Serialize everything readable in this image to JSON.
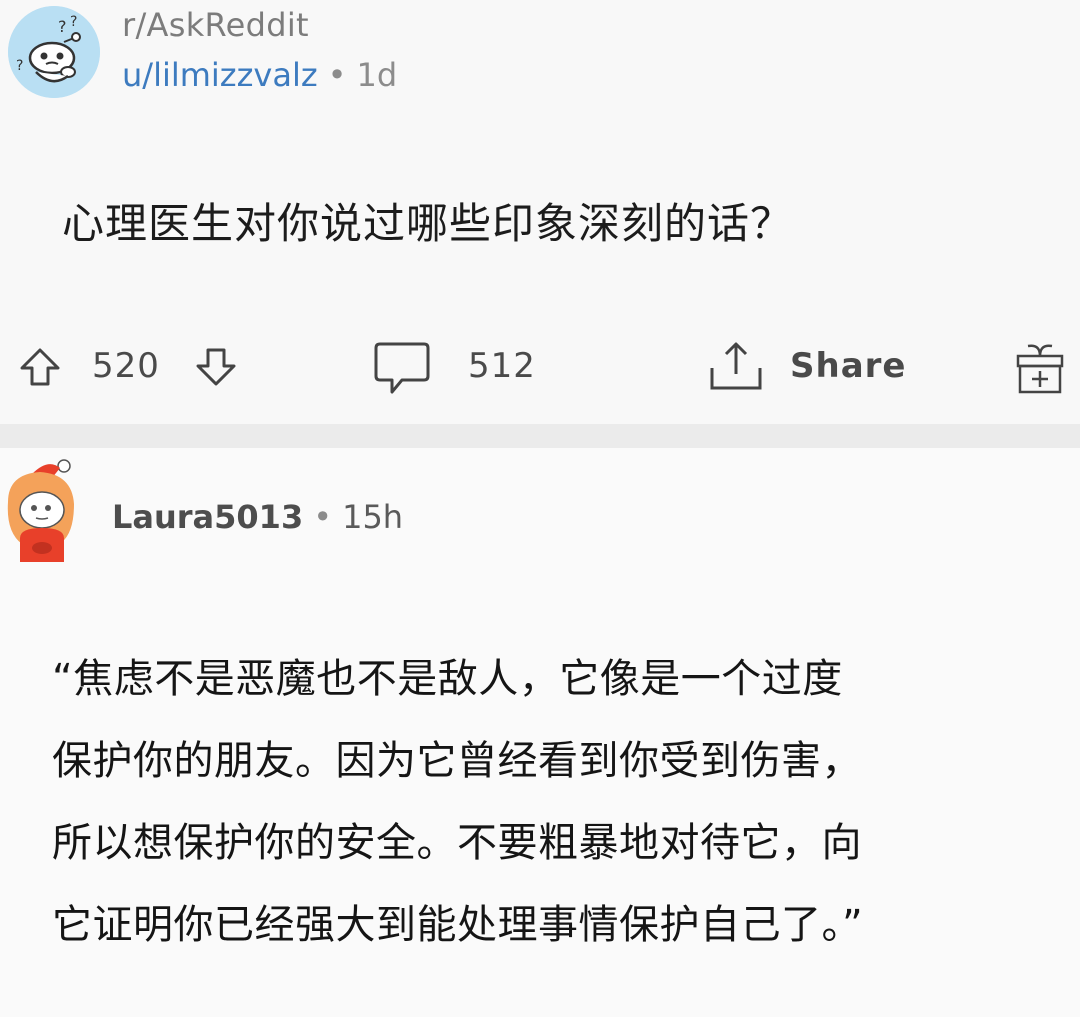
{
  "post": {
    "subreddit": "r/AskReddit",
    "author": "u/lilmizzvalz",
    "separator": "•",
    "age": "1d",
    "title": "心理医生对你说过哪些印象深刻的话？",
    "actions": {
      "upvotes": "520",
      "comments": "512",
      "share_label": "Share"
    }
  },
  "comment": {
    "author": "Laura5013",
    "separator": "•",
    "age": "15h",
    "lines": [
      "“焦虑不是恶魔也不是敌人，它像是一个过度",
      "保护你的朋友。因为它曾经看到你受到伤害，",
      "所以想保护你的安全。不要粗暴地对待它，向",
      "它证明你已经强大到能处理事情保护自己了。”"
    ]
  },
  "colors": {
    "username_blue": "#3d7bbf",
    "subreddit_avatar_bg": "#b9dff3",
    "comment_avatar_red": "#e8402a"
  },
  "icons": {
    "subreddit": "snoo-question-avatar",
    "upvote": "arrow-up-icon",
    "downvote": "arrow-down-icon",
    "comment": "speech-bubble-icon",
    "share": "share-icon",
    "award": "gift-icon",
    "commenter": "snoo-red-hair-avatar"
  }
}
